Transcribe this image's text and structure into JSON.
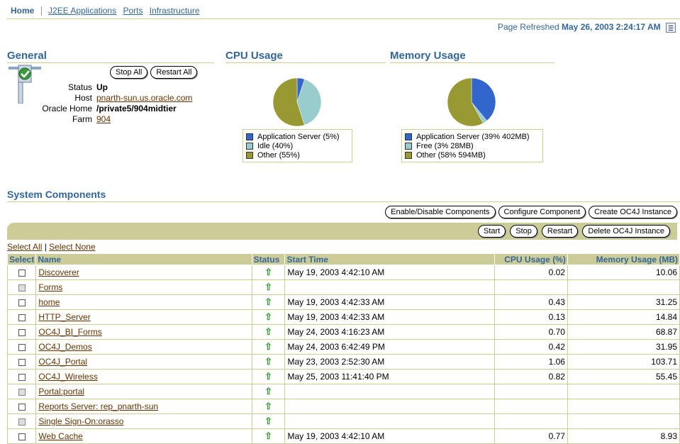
{
  "tabs": {
    "home": "Home",
    "items": [
      "J2EE Applications",
      "Ports",
      "Infrastructure"
    ]
  },
  "refresh": {
    "label": "Page Refreshed",
    "datetime": "May 26, 2003 2:24:17 AM"
  },
  "general": {
    "title": "General",
    "stop_all": "Stop All",
    "restart_all": "Restart All",
    "status_label": "Status",
    "status_value": "Up",
    "host_label": "Host",
    "host_value": "pnarth-sun.us.oracle.com",
    "oracle_home_label": "Oracle Home",
    "oracle_home_value": "/private5/904midtier",
    "farm_label": "Farm",
    "farm_value": "904"
  },
  "cpu": {
    "title": "CPU Usage",
    "slices": [
      {
        "label": "Application Server (5%)",
        "pct": 5,
        "color": "#3366cc"
      },
      {
        "label": "Idle (40%)",
        "pct": 40,
        "color": "#99cccc"
      },
      {
        "label": "Other (55%)",
        "pct": 55,
        "color": "#999933"
      }
    ]
  },
  "memory": {
    "title": "Memory Usage",
    "slices": [
      {
        "label": "Application Server (39% 402MB)",
        "pct": 39,
        "color": "#3366cc"
      },
      {
        "label": "Free (3% 28MB)",
        "pct": 3,
        "color": "#99cccc"
      },
      {
        "label": "Other (58% 594MB)",
        "pct": 58,
        "color": "#999933"
      }
    ]
  },
  "system": {
    "title": "System Components",
    "toolbar": [
      "Enable/Disable Components",
      "Configure Component",
      "Create OC4J Instance"
    ],
    "actions": [
      "Start",
      "Stop",
      "Restart",
      "Delete OC4J Instance"
    ],
    "select_all": "Select All",
    "select_sep": "|",
    "select_none": "Select None",
    "columns": [
      "Select",
      "Name",
      "Status",
      "Start Time",
      "CPU Usage (%)",
      "Memory Usage (MB)"
    ],
    "status_glyph": "⇧",
    "rows": [
      {
        "name": "Discoverer",
        "disabled": false,
        "start": "May 19, 2003 4:42:10 AM",
        "cpu": "0.02",
        "mem": "10.06"
      },
      {
        "name": "Forms",
        "disabled": true,
        "start": "",
        "cpu": "",
        "mem": ""
      },
      {
        "name": "home",
        "disabled": false,
        "start": "May 19, 2003 4:42:33 AM",
        "cpu": "0.43",
        "mem": "31.25"
      },
      {
        "name": "HTTP_Server",
        "disabled": false,
        "start": "May 19, 2003 4:42:33 AM",
        "cpu": "0.13",
        "mem": "14.84"
      },
      {
        "name": "OC4J_BI_Forms",
        "disabled": false,
        "start": "May 24, 2003 4:16:23 AM",
        "cpu": "0.70",
        "mem": "68.87"
      },
      {
        "name": "OC4J_Demos",
        "disabled": false,
        "start": "May 24, 2003 6:42:49 PM",
        "cpu": "0.42",
        "mem": "31.95"
      },
      {
        "name": "OC4J_Portal",
        "disabled": false,
        "start": "May 23, 2003 2:52:30 AM",
        "cpu": "1.06",
        "mem": "103.71"
      },
      {
        "name": "OC4J_Wireless",
        "disabled": false,
        "start": "May 25, 2003 11:41:40 PM",
        "cpu": "0.82",
        "mem": "55.45"
      },
      {
        "name": "Portal:portal",
        "disabled": true,
        "start": "",
        "cpu": "",
        "mem": ""
      },
      {
        "name": "Reports Server: rep_pnarth-sun",
        "disabled": false,
        "start": "",
        "cpu": "",
        "mem": ""
      },
      {
        "name": "Single Sign-On:orasso",
        "disabled": true,
        "start": "",
        "cpu": "",
        "mem": ""
      },
      {
        "name": "Web Cache",
        "disabled": false,
        "start": "May 19, 2003 4:42:10 AM",
        "cpu": "0.77",
        "mem": "8.93"
      }
    ]
  }
}
